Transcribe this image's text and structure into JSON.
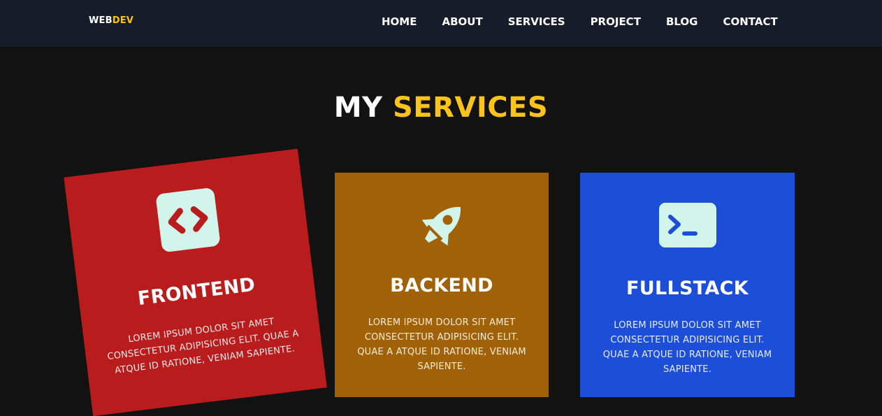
{
  "header": {
    "logo_main": "WEB",
    "logo_accent": "DEV",
    "nav": [
      "HOME",
      "ABOUT",
      "SERVICES",
      "PROJECT",
      "BLOG",
      "CONTACT"
    ]
  },
  "section": {
    "title_main": "MY",
    "title_accent": "SERVICES"
  },
  "cards": [
    {
      "title": "FRONTEND",
      "description": "LOREM IPSUM DOLOR SIT AMET CONSECTETUR ADIPISICING ELIT. QUAE A ATQUE ID RATIONE, VENIAM SAPIENTE.",
      "icon": "code-icon",
      "color": "#b91c1c"
    },
    {
      "title": "BACKEND",
      "description": "LOREM IPSUM DOLOR SIT AMET CONSECTETUR ADIPISICING ELIT. QUAE A ATQUE ID RATIONE, VENIAM SAPIENTE.",
      "icon": "rocket-icon",
      "color": "#a16207"
    },
    {
      "title": "FULLSTACK",
      "description": "LOREM IPSUM DOLOR SIT AMET CONSECTETUR ADIPISICING ELIT. QUAE A ATQUE ID RATIONE, VENIAM SAPIENTE.",
      "icon": "terminal-icon",
      "color": "#1d4ed8"
    }
  ],
  "colors": {
    "accent": "#fcc419",
    "nav_background": "#161c29",
    "page_background": "#121212",
    "icon_fill": "#d1f5ea"
  }
}
